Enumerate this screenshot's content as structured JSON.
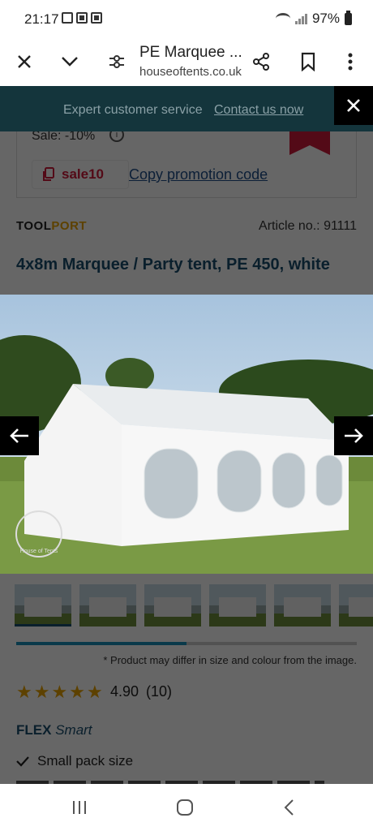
{
  "status": {
    "time": "21:17",
    "battery": "97%"
  },
  "toolbar": {
    "title": "PE Marquee ...",
    "url": "houseoftents.co.uk"
  },
  "banner": {
    "text": "Expert customer service",
    "link": "Contact us now"
  },
  "promo": {
    "sale": "Sale: -10%",
    "coupon_code": "sale10",
    "copy_link": "Copy promotion code"
  },
  "product": {
    "brand": {
      "part1": "TOOL",
      "part2": "PORT"
    },
    "article": "Article no.: 91111",
    "title": "4x8m Marquee / Party tent, PE 450, white",
    "watermark": "House of Tents",
    "thumbnail_count": 6,
    "gallery_progress": 0.5,
    "disclaimer": "* Product may differ in size and colour from the image.",
    "rating": "4.90",
    "rating_stars": 5,
    "rating_count": "(10)",
    "flex": {
      "bold": "FLEX",
      "italic": "Smart"
    },
    "features": [
      "Small pack size"
    ]
  },
  "colors": {
    "banner": "#14353c",
    "accent": "#d01a3a",
    "title": "#1a4e6e",
    "stars": "#e8a300"
  },
  "icons": [
    "close-icon",
    "chevron-down-icon",
    "site-settings-icon",
    "share-icon",
    "bookmark-icon",
    "more-vert-icon",
    "arrow-left-icon",
    "arrow-right-icon",
    "copy-icon",
    "info-icon",
    "check-icon",
    "recents-icon",
    "home-icon",
    "back-icon"
  ]
}
